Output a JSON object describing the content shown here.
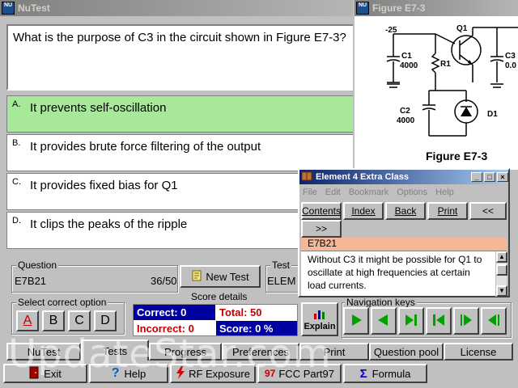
{
  "main_window": {
    "title": "NuTest",
    "icon_text": "NU",
    "question_text": "What is the purpose of C3 in the circuit shown in Figure E7-3?",
    "answers": [
      {
        "letter": "A.",
        "text": "It prevents self-oscillation"
      },
      {
        "letter": "B.",
        "text": "It provides brute force filtering of the output"
      },
      {
        "letter": "C.",
        "text": "It provides fixed bias for Q1"
      },
      {
        "letter": "D.",
        "text": "It clips the peaks of the ripple"
      }
    ],
    "question_group": {
      "label": "Question",
      "id": "E7B21",
      "progress": "36/50"
    },
    "new_test_label": "New Test",
    "test_group": {
      "label": "Test",
      "value": "ELEM"
    },
    "select_group": {
      "label": "Select correct option",
      "options": [
        "A",
        "B",
        "C",
        "D"
      ]
    },
    "score": {
      "label": "Score details",
      "correct": "Correct: 0",
      "total": "Total: 50",
      "incorrect": "Incorrect: 0",
      "score": "Score: 0 %"
    },
    "explain_label": "Explain",
    "nav_label": "Navigation keys",
    "tabs": [
      "NuTest",
      "Tests",
      "Progress",
      "Preferences",
      "Print",
      "Question pool",
      "License"
    ],
    "bottom_buttons": [
      "Exit",
      "Help",
      "RF Exposure",
      "FCC Part97",
      "Formula"
    ],
    "bottom_icons": {
      "fcc": "97",
      "formula": "Σ"
    }
  },
  "figure_window": {
    "title": "Figure E7-3",
    "icon_text": "NU",
    "labels": {
      "voltage": "-25",
      "q1": "Q1",
      "c1": "C1",
      "c1_val": "4000",
      "r1": "R1",
      "c2": "C2",
      "c2_val": "4000",
      "d1": "D1",
      "c3": "C3",
      "c3_val": "0.0",
      "caption": "Figure E7-3"
    }
  },
  "help_window": {
    "title": "Element 4 Extra Class",
    "menu": [
      "File",
      "Edit",
      "Bookmark",
      "Options",
      "Help"
    ],
    "buttons": [
      "Contents",
      "Index",
      "Back",
      "Print",
      "<<",
      ">>"
    ],
    "topic": "E7B21",
    "text": "Without C3 it might be possible for Q1 to oscillate at high frequencies at certain load currents."
  },
  "watermark": "UpdateStar.com",
  "colors": {
    "correct_answer": "#a8e89a",
    "score_bg": "#0000a0",
    "help_topic_bg": "#f4b898",
    "nav_arrow": "#00a000"
  }
}
